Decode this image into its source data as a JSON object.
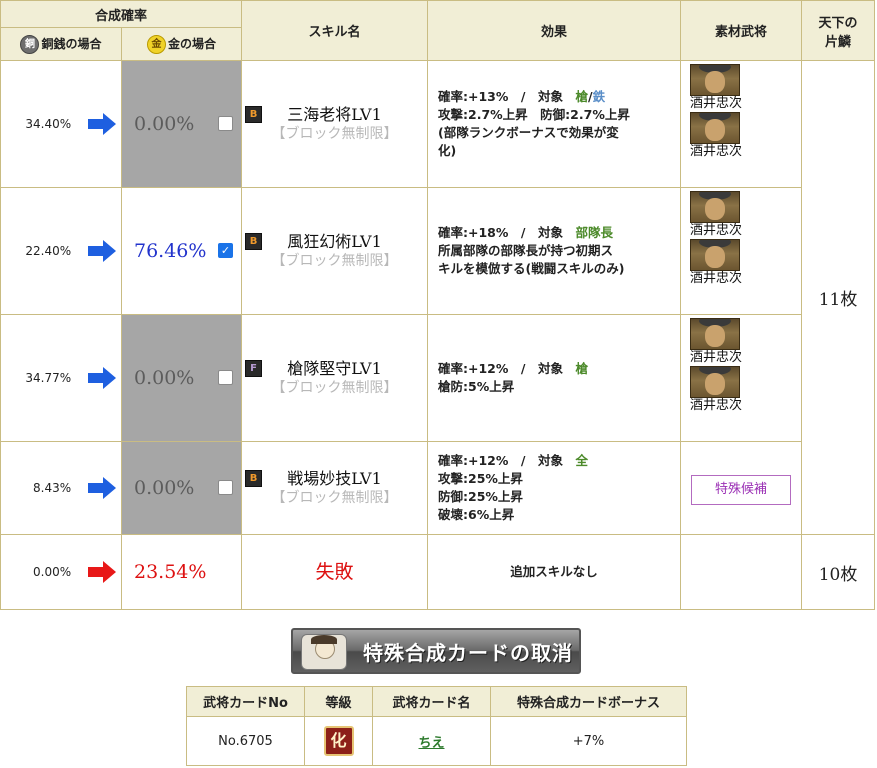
{
  "header": {
    "rate_title": "合成確率",
    "copper_coin": "銅",
    "copper_label": "銅銭の場合",
    "gold_coin": "金",
    "gold_label": "金の場合",
    "skill_name": "スキル名",
    "effect": "効果",
    "material": "素材武将",
    "tenka_line1": "天下の",
    "tenka_line2": "片鱗"
  },
  "rows": [
    {
      "copper_pct": "34.40%",
      "gold_pct": "0.00%",
      "checked": false,
      "rank": "B",
      "skill": "三海老将LV1",
      "sub": "【ブロック無制限】",
      "effect": {
        "line1_a": "確率:+13%　/　対象　",
        "target1": "槍",
        "slash": "/",
        "target2": "鉄",
        "line2": "攻撃:2.7%上昇　防御:2.7%上昇",
        "line3": "(部隊ランクボーナスで効果が変",
        "line4": "化)"
      },
      "materials": [
        "酒井忠次",
        "酒井忠次"
      ]
    },
    {
      "copper_pct": "22.40%",
      "gold_pct": "76.46%",
      "checked": true,
      "check_glyph": "✓",
      "rank": "B",
      "skill": "風狂幻術LV1",
      "sub": "【ブロック無制限】",
      "effect": {
        "line1_a": "確率:+18%　/　対象　",
        "target1": "部隊長",
        "line2": "所属部隊の部隊長が持つ初期ス",
        "line3": "キルを模倣する(戦闘スキルのみ)"
      },
      "materials": [
        "酒井忠次",
        "酒井忠次"
      ]
    },
    {
      "copper_pct": "34.77%",
      "gold_pct": "0.00%",
      "checked": false,
      "rank": "F",
      "skill": "槍隊堅守LV1",
      "sub": "【ブロック無制限】",
      "effect": {
        "line1_a": "確率:+12%　/　対象　",
        "target1": "槍",
        "line2": "槍防:5%上昇"
      },
      "materials": [
        "酒井忠次",
        "酒井忠次"
      ]
    },
    {
      "copper_pct": "8.43%",
      "gold_pct": "0.00%",
      "checked": false,
      "rank": "B",
      "skill": "戦場妙技LV1",
      "sub": "【ブロック無制限】",
      "effect": {
        "line1_a": "確率:+12%　/　対象　",
        "target1": "全",
        "line2": "攻撃:25%上昇",
        "line3": "防御:25%上昇",
        "line4": "破壊:6%上昇"
      },
      "special_button": "特殊候補"
    }
  ],
  "tenka_top": "11枚",
  "fail_row": {
    "copper_pct": "0.00%",
    "gold_pct": "23.54%",
    "label": "失敗",
    "effect": "追加スキルなし",
    "tenka": "10枚"
  },
  "cancel_button": "特殊合成カードの取消",
  "card_table": {
    "headers": [
      "武将カードNo",
      "等級",
      "武将カード名",
      "特殊合成カードボーナス"
    ],
    "no": "No.6705",
    "grade": "化",
    "name": "ちえ",
    "bonus": "+7%"
  },
  "colors": {
    "header_bg": "#f1eed6",
    "border": "#c9bc83",
    "arrow_blue": "#1e5fe0",
    "arrow_red": "#e81818",
    "gold_on": "#2233cc",
    "fail_red": "#dd1111",
    "target_green": "#4c8a2a",
    "target_blue": "#5a8ec8"
  },
  "icons": {
    "arrow": "right-arrow-icon",
    "copper_coin": "copper-coin-icon",
    "gold_coin": "gold-coin-icon",
    "rank_badge": "rank-badge-icon",
    "portrait": "general-portrait-icon"
  }
}
